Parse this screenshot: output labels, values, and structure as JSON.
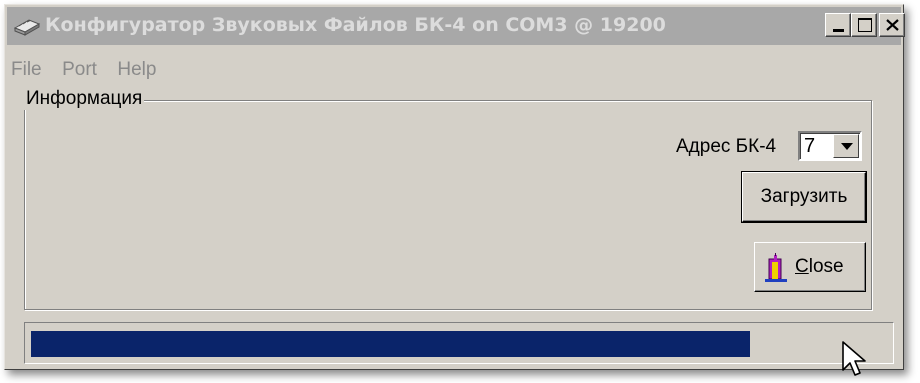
{
  "window": {
    "title": "Конфигуратор Звуковых Файлов БК-4  on COM3 @ 19200",
    "controls": {
      "minimize": "_",
      "maximize": "□",
      "close": "×"
    }
  },
  "menu": [
    {
      "label": "File"
    },
    {
      "label": "Port"
    },
    {
      "label": "Help"
    }
  ],
  "info_group": {
    "label": "Информация",
    "address_label": "Адрес БК-4",
    "address_value": "7",
    "load_button": "Загрузить",
    "close_button_first": "C",
    "close_button_rest": "lose"
  },
  "progress": {
    "fraction": 0.84
  },
  "colors": {
    "progress_fill": "#0a246a",
    "face": "#d4d0c8",
    "titlebar_inactive": "#a8a8a8"
  },
  "icons": [
    "app-chip-icon",
    "minimize-icon",
    "maximize-icon",
    "close-window-icon",
    "dropdown-arrow-icon",
    "door-exit-icon",
    "mouse-cursor-icon"
  ]
}
